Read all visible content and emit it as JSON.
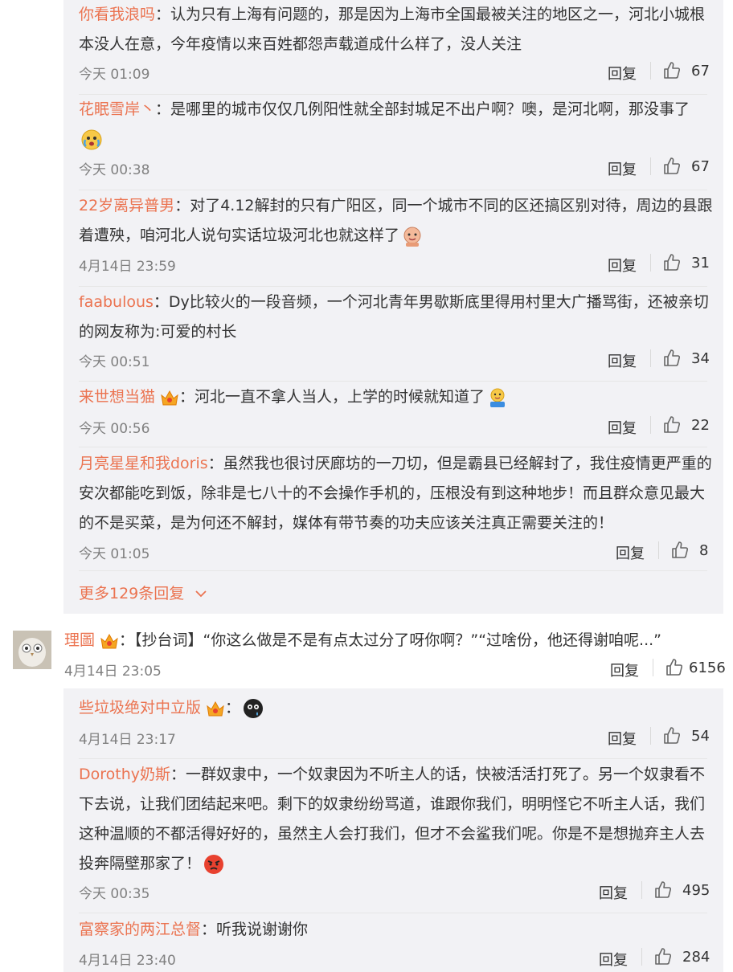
{
  "comments_top": [
    {
      "user": "你看我浪吗",
      "line1": "：认为只有上海有问题的，那是因为上海市全国最被关注的地区之一，河北小城根",
      "line2": "本没人在意，今年疫情以来百姓都怨声载道成什么样了，没人关注",
      "time": "今天 01:09",
      "reply": "回复",
      "likes": "67"
    },
    {
      "user": "花眠雪岸丶",
      "line1": "：是哪里的城市仅仅几例阳性就全部封城足不出户啊？噢，是河北啊，那没事了",
      "time": "今天 00:38",
      "reply": "回复",
      "likes": "67"
    },
    {
      "user": "22岁离异普男",
      "line1": "：对了4.12解封的只有广阳区，同一个城市不同的区还搞区别对待，周边的县跟",
      "line2": "着遭殃，咱河北人说句实话垃圾河北也就这样了",
      "time": "4月14日 23:59",
      "reply": "回复",
      "likes": "31"
    },
    {
      "user": "faabulous",
      "line1": "：Dy比较火的一段音频，一个河北青年男歇斯底里得用村里大广播骂街，还被亲切",
      "line2": "的网友称为:可爱的村长",
      "time": "今天 00:51",
      "reply": "回复",
      "likes": "34"
    },
    {
      "user": "来世想当猫",
      "line1": "：河北一直不拿人当人，上学的时候就知道了",
      "time": "今天 00:56",
      "reply": "回复",
      "likes": "22"
    },
    {
      "user": "月亮星星和我doris",
      "line1": "：虽然我也很讨厌廊坊的一刀切，但是霸县已经解封了，我住疫情更严重的",
      "line2": "安次都能吃到饭，除非是七八十的不会操作手机的，压根没有到这种地步！而且群众意见最大",
      "line3": "的不是买菜，是为何还不解封，媒体有带节奏的功夫应该关注真正需要关注的！",
      "time": "今天 01:05",
      "reply": "回复",
      "likes": "8"
    }
  ],
  "more_replies": "更多129条回复",
  "main_comment": {
    "user": "理圖",
    "text": "：【抄台词】“你这么做是不是有点太过分了呀你啊？”“过啥份，他还得谢咱呢...”",
    "time": "4月14日 23:05",
    "reply": "回复",
    "likes": "6156"
  },
  "replies_bottom": [
    {
      "user": "些垃圾绝对中立版",
      "line1": "：",
      "time": "4月14日 23:17",
      "reply": "回复",
      "likes": "54"
    },
    {
      "user": "Dorothy奶斯",
      "line1": "：一群奴隶中，一个奴隶因为不听主人的话，快被活活打死了。另一个奴隶看不",
      "line2": "下去说，让我们团结起来吧。剩下的奴隶纷纷骂道，谁跟你我们，明明怪它不听主人话，我们",
      "line3": "这种温顺的不都活得好好的，虽然主人会打我们，但才不会鲨我们呢。你是不是想抛弃主人去",
      "line4": "投奔隔壁那家了！",
      "time": "今天 00:35",
      "reply": "回复",
      "likes": "495"
    },
    {
      "user": "富察家的两江总督",
      "line1": "：听我说谢谢你",
      "time": "4月14日 23:40",
      "reply": "回复",
      "likes": "284"
    }
  ],
  "colors": {
    "username": "#eb7350",
    "text": "#333333",
    "time": "#808080",
    "panel": "#f2f2f5"
  }
}
